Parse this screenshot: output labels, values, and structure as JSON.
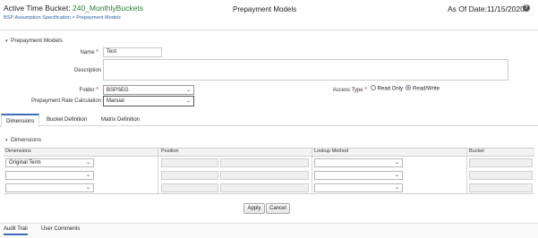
{
  "header": {
    "title_prefix": "Active Time Bucket: ",
    "title_value": "240_MonthlyBuckets",
    "breadcrumb": "BSP Assumption Specification > Prepayment Models",
    "page_title": "Prepayment Models",
    "as_of_label": "As Of Date:",
    "as_of_value": "11/15/2020",
    "help_glyph": "?"
  },
  "prepayment_models": {
    "section_title": "Prepayment Models",
    "name_label": "Name",
    "name_value": "Test",
    "description_label": "Description",
    "description_value": "",
    "folder_label": "Folder",
    "folder_value": "BSPSEG",
    "calc_label": "Prepayment Rate Calculation",
    "calc_value": "Manual",
    "access_label": "Access Type",
    "access_options": [
      "Read Only",
      "Read/Write"
    ],
    "access_selected": "Read/Write"
  },
  "tabs": [
    "Dimensions",
    "Bucket Definition",
    "Matrix Definition"
  ],
  "active_tab": "Dimensions",
  "dimensions": {
    "section_title": "Dimensions",
    "columns": [
      "Dimensions",
      "Position",
      "Lookup Method",
      "Bucket"
    ],
    "rows": [
      {
        "dimension": "Original Term",
        "lookup": ""
      },
      {
        "dimension": "",
        "lookup": ""
      },
      {
        "dimension": "",
        "lookup": ""
      }
    ]
  },
  "buttons": {
    "apply": "Apply",
    "cancel": "Cancel"
  },
  "footer_tabs": [
    "Audit Trail",
    "User Comments"
  ],
  "colors": {
    "accent": "#3b6fb6",
    "link": "#2a62a8",
    "green": "#2e7d32",
    "required": "#c62828"
  }
}
